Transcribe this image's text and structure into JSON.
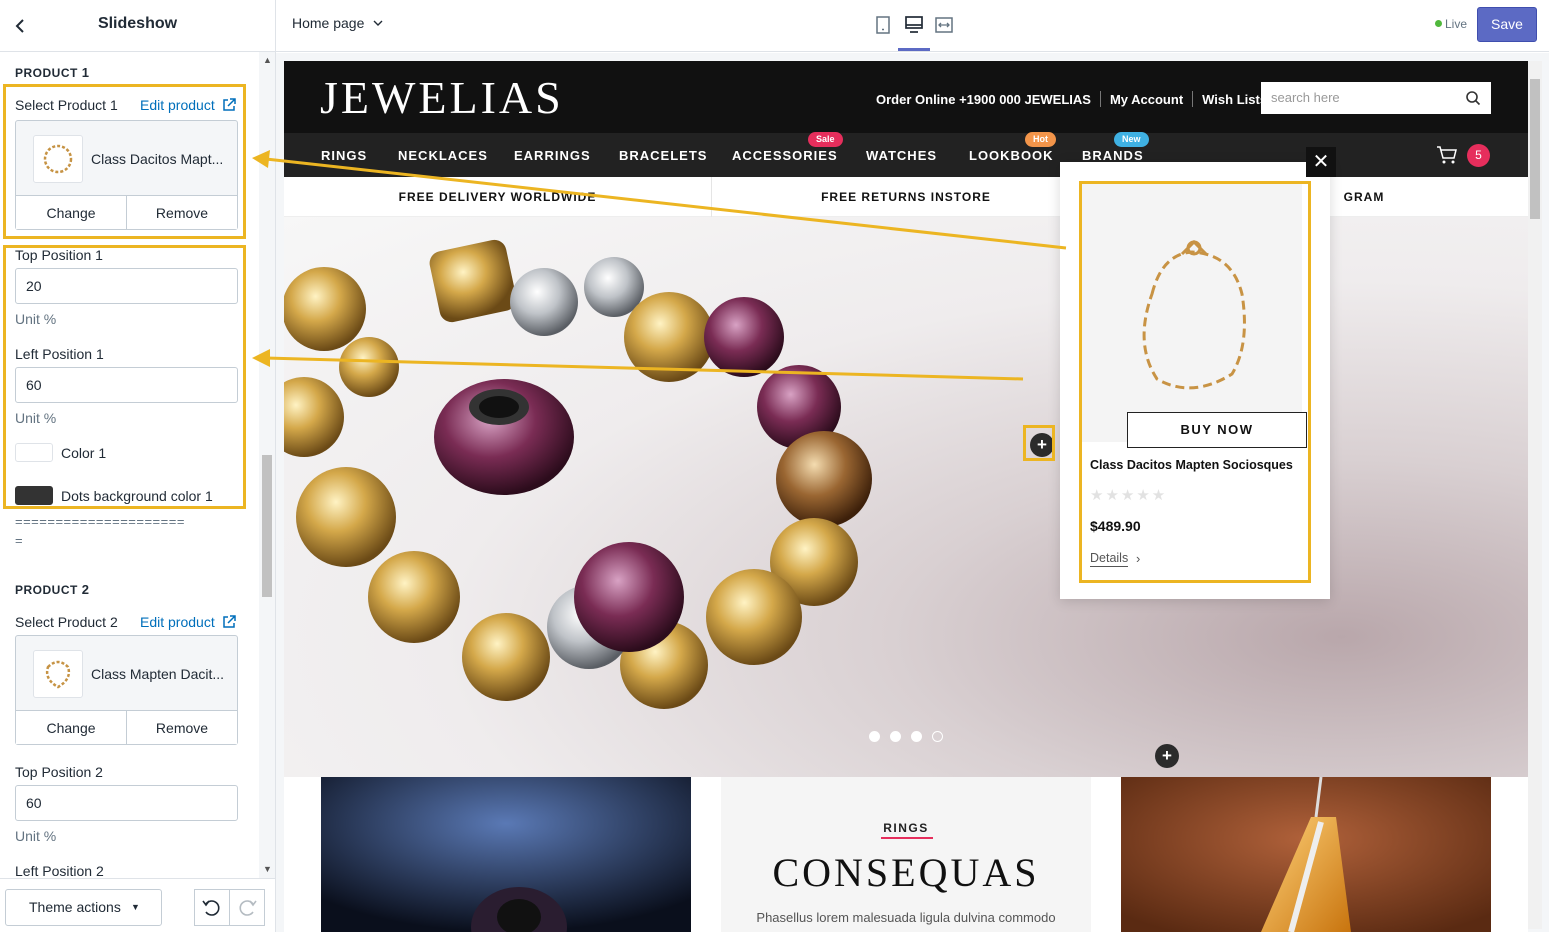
{
  "sidebar": {
    "title": "Slideshow",
    "back_icon": "chevron-left-icon",
    "product1": {
      "heading": "PRODUCT",
      "heading_num": "1",
      "select_label": "Select Product 1",
      "edit_label": "Edit product",
      "product_name": "Class Dacitos Mapt...",
      "change_label": "Change",
      "remove_label": "Remove",
      "top_label": "Top Position 1",
      "top_value": "20",
      "top_unit": "Unit %",
      "left_label": "Left Position 1",
      "left_value": "60",
      "left_unit": "Unit %",
      "color_label": "Color 1",
      "color_value": "#ffffff",
      "dots_label": "Dots background color 1",
      "dots_value": "#333333"
    },
    "divider_text": "=====================",
    "divider_tail": "=",
    "product2": {
      "heading": "PRODUCT",
      "heading_num": "2",
      "select_label": "Select Product 2",
      "edit_label": "Edit product",
      "product_name": "Class Mapten Dacit...",
      "change_label": "Change",
      "remove_label": "Remove",
      "top_label": "Top Position 2",
      "top_value": "60",
      "top_unit": "Unit %",
      "left_label": "Left Position 2"
    },
    "footer": {
      "theme_actions_label": "Theme actions"
    }
  },
  "topbar": {
    "page_label": "Home page",
    "views": [
      "mobile-view-icon",
      "desktop-view-icon",
      "fullwidth-view-icon"
    ],
    "live_label": "Live",
    "save_label": "Save"
  },
  "store": {
    "logo": "JEWELIAS",
    "header_links": [
      "Order Online +1900 000 JEWELIAS",
      "My Account",
      "Wish Lists"
    ],
    "search_placeholder": "search here",
    "nav": [
      "RINGS",
      "NECKLACES",
      "EARRINGS",
      "BRACELETS",
      "ACCESSORIES",
      "WATCHES",
      "LOOKBOOK",
      "BRANDS"
    ],
    "badges": {
      "sale": "Sale",
      "hot": "Hot",
      "new": "New"
    },
    "badge_colors": {
      "sale": "#e62e5c",
      "hot": "#f3954a",
      "new": "#3fb1e3"
    },
    "cart_count": "5",
    "features": [
      "FREE DELIVERY WORLDWIDE",
      "FREE RETURNS INSTORE",
      "GRAM"
    ],
    "hotspot_symbol": "+",
    "banner": {
      "kicker": "RINGS",
      "title": "CONSEQUAS",
      "subtitle": "Phasellus lorem malesuada ligula dulvina commodo"
    },
    "popup": {
      "close": "✕",
      "buy_now": "BUY NOW",
      "name": "Class Dacitos Mapten Sociosques",
      "stars": "★★★★★",
      "rating": 0,
      "price": "$489.90",
      "details": "Details",
      "details_chevron": "›"
    }
  },
  "colors": {
    "highlight": "#ecb522",
    "accent": "#5c6ac4",
    "link": "#006fbb"
  }
}
